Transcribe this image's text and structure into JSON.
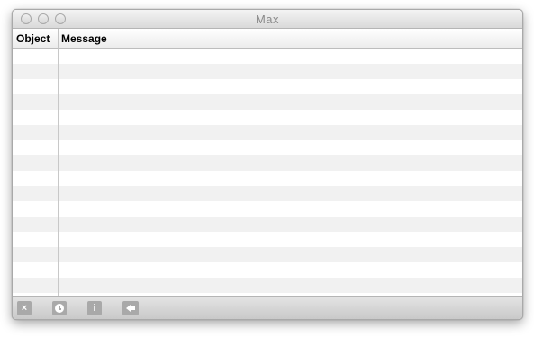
{
  "window": {
    "title": "Max"
  },
  "table": {
    "columns": [
      {
        "label": "Object"
      },
      {
        "label": "Message"
      }
    ],
    "rows": []
  },
  "footer": {
    "buttons": [
      {
        "name": "clear-button",
        "icon": "x-icon",
        "glyph": "×"
      },
      {
        "name": "timestamp-button",
        "icon": "clock-icon"
      },
      {
        "name": "info-button",
        "icon": "info-icon",
        "glyph": "i"
      },
      {
        "name": "back-button",
        "icon": "arrow-left-icon"
      }
    ]
  },
  "colors": {
    "row_alt": "#f1f1f1",
    "footer_button": "#a9a9a9"
  }
}
